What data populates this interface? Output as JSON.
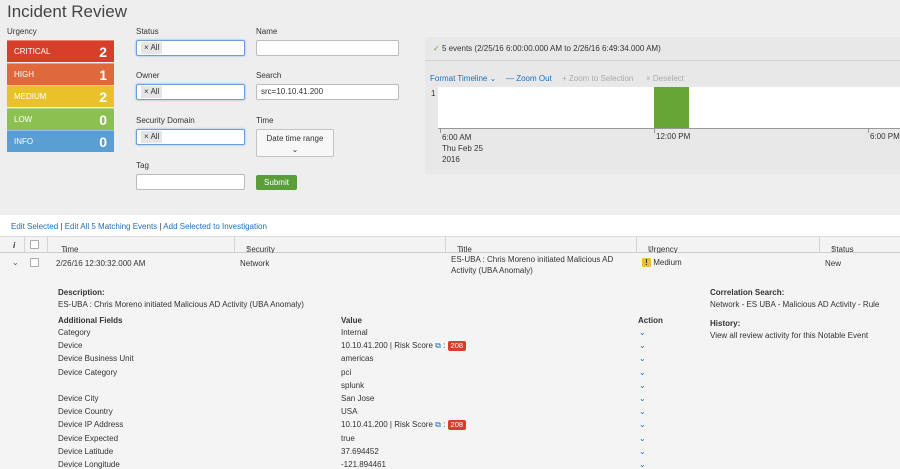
{
  "page_title": "Incident Review",
  "urgency": {
    "label": "Urgency",
    "rows": [
      {
        "name": "CRITICAL",
        "count": "2",
        "color": "#d6402b"
      },
      {
        "name": "HIGH",
        "count": "1",
        "color": "#e0693c"
      },
      {
        "name": "MEDIUM",
        "count": "2",
        "color": "#e8c12b"
      },
      {
        "name": "LOW",
        "count": "0",
        "color": "#8cc152"
      },
      {
        "name": "INFO",
        "count": "0",
        "color": "#5a9fd4"
      }
    ]
  },
  "filters": {
    "status_label": "Status",
    "status_token": "All",
    "name_label": "Name",
    "name_value": "",
    "owner_label": "Owner",
    "owner_token": "All",
    "search_label": "Search",
    "search_value": "src=10.10.41.200",
    "domain_label": "Security Domain",
    "domain_token": "All",
    "time_label": "Time",
    "time_button": "Date time range",
    "tag_label": "Tag",
    "tag_value": "",
    "submit_label": "Submit"
  },
  "timeline": {
    "summary": "5 events (2/25/16 6:00:00.000 AM to 2/26/16 6:49:34.000 AM)",
    "format_label": "Format Timeline",
    "zoom_out": "— Zoom Out",
    "zoom_selection": "+ Zoom to Selection",
    "deselect": "× Deselect",
    "y_tick": "1",
    "x_tick_1_line1": "6:00 AM",
    "x_tick_1_line2": "Thu Feb 25",
    "x_tick_1_line3": "2016",
    "x_tick_2": "12:00 PM",
    "x_tick_3": "6:00 PM",
    "bar_color": "#65a637"
  },
  "actions": {
    "edit_selected": "Edit Selected",
    "edit_all": "Edit All 5 Matching Events",
    "add_investigation": "Add Selected to Investigation",
    "sep": "|"
  },
  "table": {
    "headers": {
      "info": "i",
      "time": "Time",
      "domain": "Security Domain",
      "title": "Title",
      "urgency": "Urgency",
      "status": "Status"
    },
    "row": {
      "time": "2/26/16 12:30:32.000 AM",
      "domain": "Network",
      "title_line1": "ES-UBA : Chris Moreno initiated Malicious AD",
      "title_line2": "Activity (UBA Anomaly)",
      "urgency_icon": "!",
      "urgency": "Medium",
      "status": "New"
    }
  },
  "details": {
    "description_label": "Description:",
    "description": "ES-UBA : Chris Moreno initiated Malicious AD Activity (UBA Anomaly)",
    "fields_header": "Additional Fields",
    "value_header": "Value",
    "action_header": "Action",
    "rows": [
      {
        "field": "Category",
        "value": "Internal"
      },
      {
        "field": "Device",
        "value": "10.10.41.200 | Risk Score",
        "badge": "208"
      },
      {
        "field": "Device Business Unit",
        "value": "americas"
      },
      {
        "field": "Device Category",
        "value": "pci"
      },
      {
        "field": "",
        "value": "splunk"
      },
      {
        "field": "Device City",
        "value": "San Jose"
      },
      {
        "field": "Device Country",
        "value": "USA"
      },
      {
        "field": "Device IP Address",
        "value": "10.10.41.200 | Risk Score",
        "badge": "208"
      },
      {
        "field": "Device Expected",
        "value": "true"
      },
      {
        "field": "Device Latitude",
        "value": "37.694452"
      },
      {
        "field": "Device Longitude",
        "value": "-121.894461"
      }
    ],
    "correlation_label": "Correlation Search:",
    "correlation_link": "Network - ES UBA - Malicious AD Activity - Rule",
    "history_label": "History:",
    "history_link": "View all review activity for this Notable Event"
  }
}
